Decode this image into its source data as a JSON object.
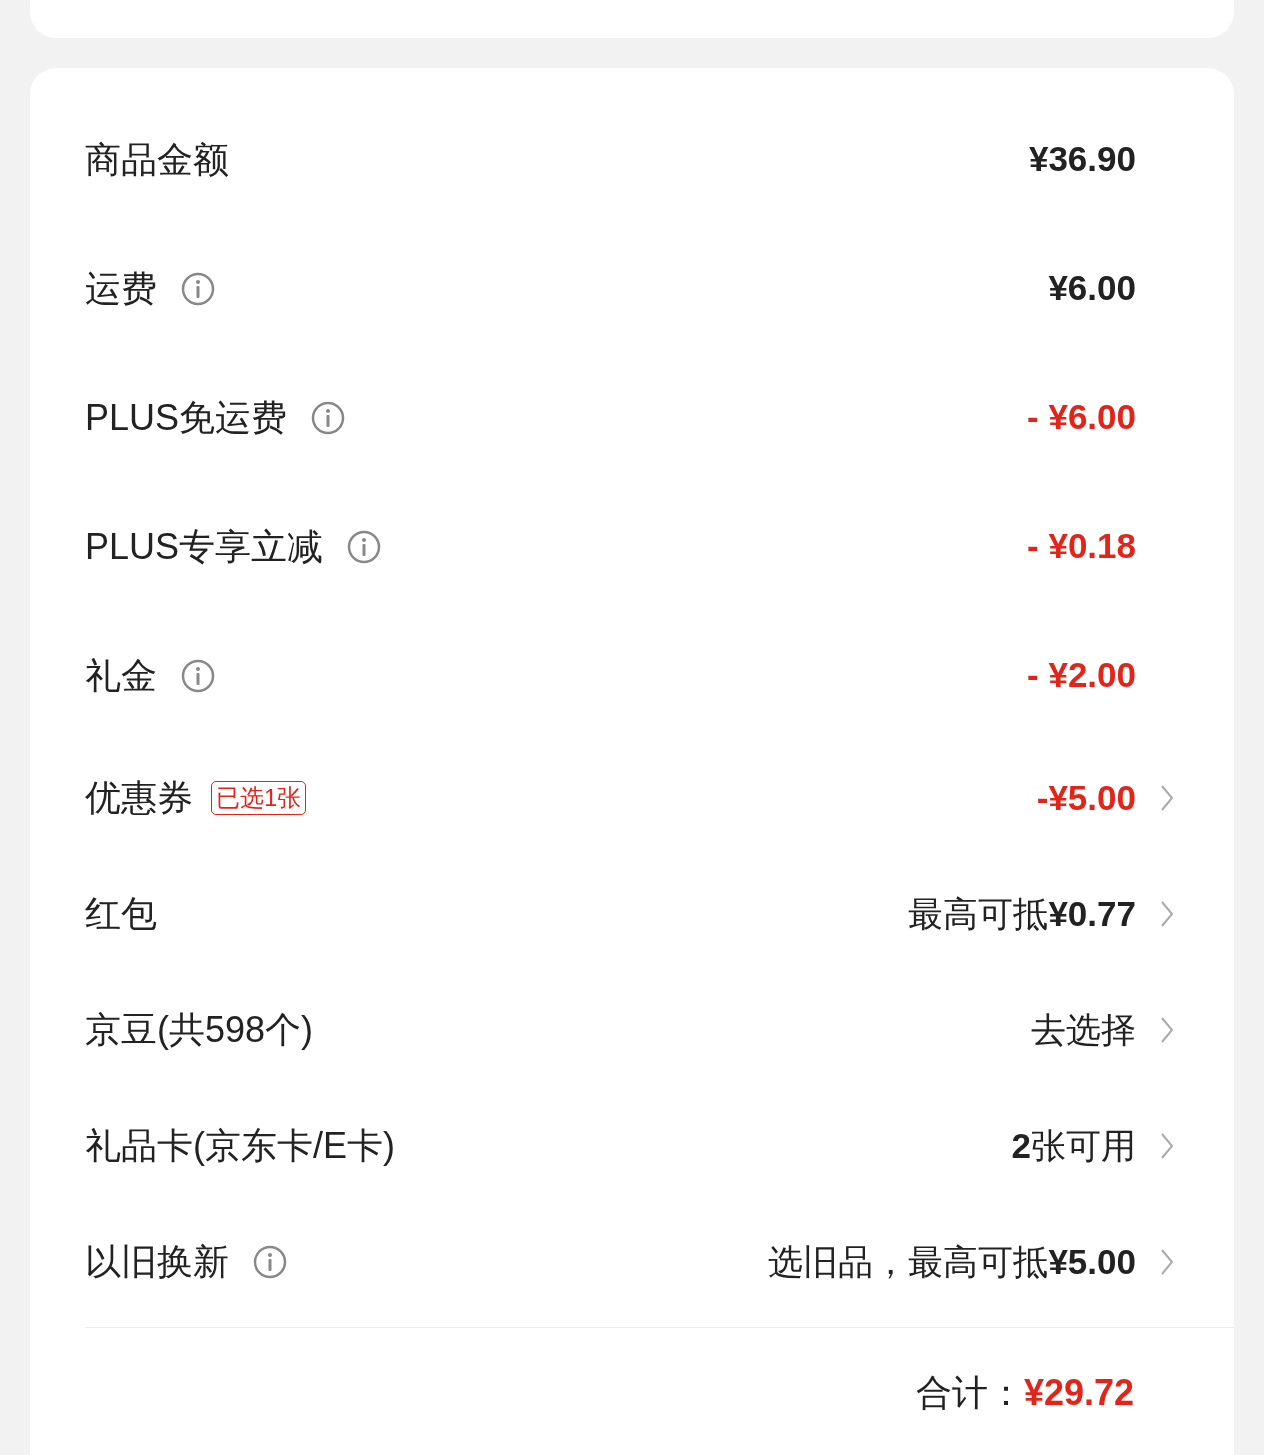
{
  "rows": [
    {
      "label": "商品金额",
      "info": false,
      "value": "¥36.90",
      "kind": "amount",
      "chevron": false
    },
    {
      "label": "运费",
      "info": true,
      "value": "¥6.00",
      "kind": "amount",
      "chevron": false
    },
    {
      "label": "PLUS免运费",
      "info": true,
      "value": "- ¥6.00",
      "kind": "discount",
      "chevron": false
    },
    {
      "label": "PLUS专享立减",
      "info": true,
      "value": "- ¥0.18",
      "kind": "discount",
      "chevron": false
    },
    {
      "label": "礼金",
      "info": true,
      "value": "- ¥2.00",
      "kind": "discount",
      "chevron": false
    },
    {
      "label": "优惠券",
      "info": false,
      "tag": "已选1张",
      "value": "-¥5.00",
      "kind": "discount",
      "chevron": true
    },
    {
      "label": "红包",
      "info": false,
      "value": "最高可抵**¥0.77**",
      "kind": "text",
      "chevron": true
    },
    {
      "label": "京豆(共598个)",
      "info": false,
      "value": "去选择",
      "kind": "text",
      "chevron": true
    },
    {
      "label": "礼品卡(京东卡/E卡)",
      "info": false,
      "value": "**2**张可用",
      "kind": "text",
      "chevron": true
    },
    {
      "label": "以旧换新",
      "info": true,
      "value": "选旧品，最高可抵**¥5.00**",
      "kind": "text",
      "chevron": true
    }
  ],
  "total": {
    "label": "合计：",
    "value": "¥29.72"
  }
}
